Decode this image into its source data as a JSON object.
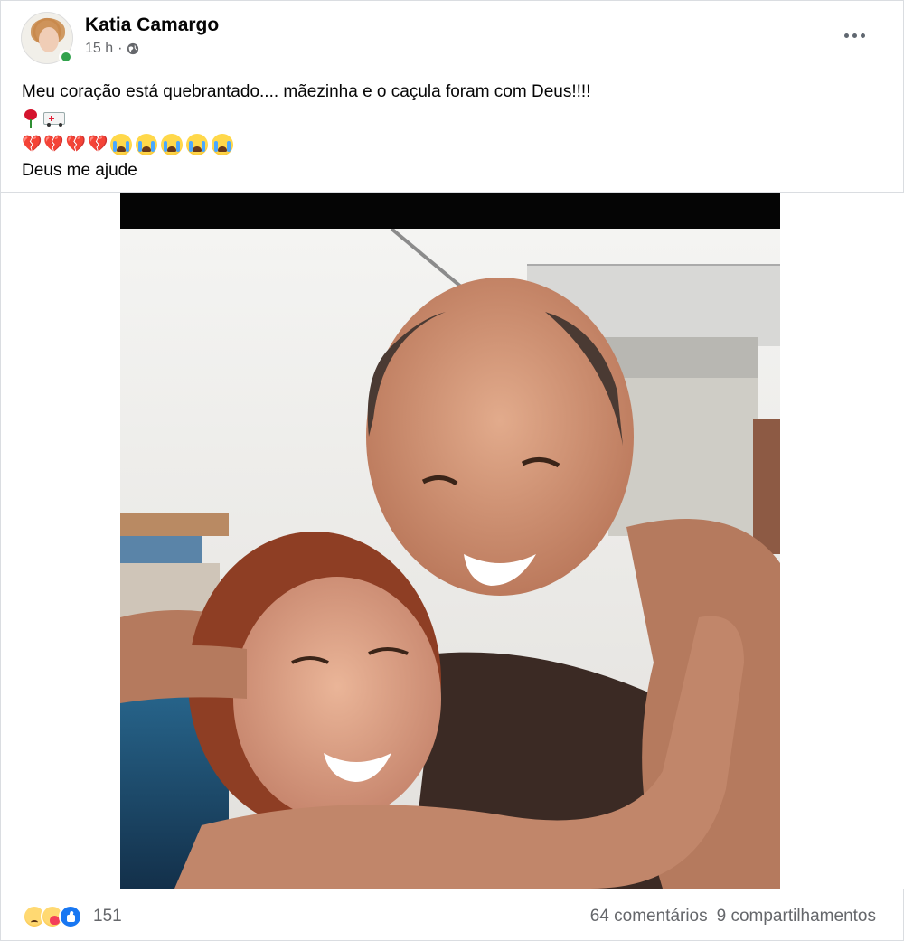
{
  "post": {
    "author": "Katia Camargo",
    "time": "15 h",
    "separator": "·",
    "icons": {
      "privacy": "globe-icon",
      "more": "more-options-icon",
      "online": "online-status-dot"
    },
    "text_line_1": "Meu coração está quebrantado.... mãezinha e o caçula foram com Deus!!!!",
    "emoji_line_2": [
      "rose-icon",
      "ambulance-icon"
    ],
    "emoji_line_3": {
      "broken_hearts": [
        "💔",
        "💔",
        "💔",
        "💔"
      ],
      "crying_faces_count": 5,
      "crying_icon": "loudly-crying-face-icon"
    },
    "text_line_4": "Deus me ajude"
  },
  "footer": {
    "reactions": [
      "sad-icon",
      "care-icon",
      "like-icon"
    ],
    "reaction_count": "151",
    "comments": "64 comentários",
    "shares": "9 compartilhamentos"
  },
  "colors": {
    "online": "#31a24c",
    "secondary_text": "#65676b",
    "like_blue": "#1877f2"
  }
}
